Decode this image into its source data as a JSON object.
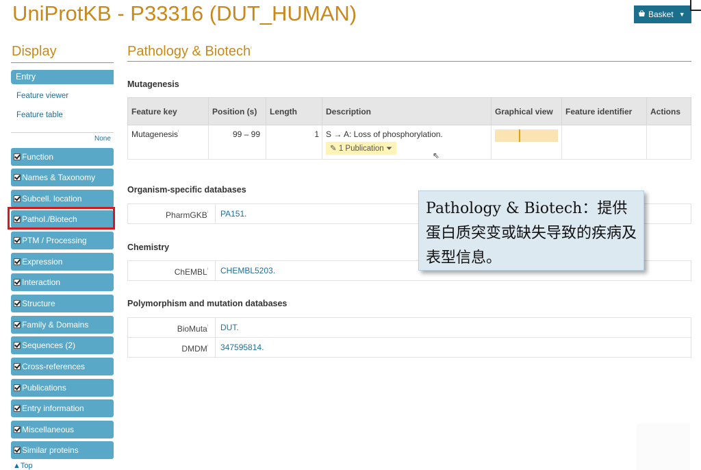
{
  "header": {
    "title": "UniProtKB - P33316 (DUT_HUMAN)",
    "basket_label": "Basket",
    "basket_icon": "basket-icon"
  },
  "sidebar": {
    "heading": "Display",
    "entry": "Entry",
    "links": [
      "Feature viewer",
      "Feature table"
    ],
    "none_label": "None",
    "sections": [
      "Function",
      "Names & Taxonomy",
      "Subcell. location",
      "Pathol./Biotech",
      "PTM / Processing",
      "Expression",
      "Interaction",
      "Structure",
      "Family & Domains",
      "Sequences (2)",
      "Cross-references",
      "Publications",
      "Entry information",
      "Miscellaneous",
      "Similar proteins"
    ],
    "highlighted": "Pathol./Biotech",
    "top_link": "Top"
  },
  "main": {
    "section_title": "Pathology & Biotech",
    "mutagenesis": {
      "heading": "Mutagenesis",
      "columns": [
        "Feature key",
        "Position (s)",
        "Length",
        "Description",
        "Graphical view",
        "Feature identifier",
        "Actions"
      ],
      "rows": [
        {
          "feature_key": "Mutagenesis",
          "position": "99 – 99",
          "length": "1",
          "description": "S → A: Loss of phosphorylation.",
          "publication": "1 Publication"
        }
      ]
    },
    "organism_db": {
      "heading": "Organism-specific databases",
      "rows": [
        {
          "key": "PharmGKB",
          "value": "PA151."
        }
      ]
    },
    "chemistry": {
      "heading": "Chemistry",
      "rows": [
        {
          "key": "ChEMBL",
          "value": "CHEMBL5203."
        }
      ]
    },
    "polymorphism": {
      "heading": "Polymorphism and mutation databases",
      "rows": [
        {
          "key": "BioMuta",
          "value": "DUT."
        },
        {
          "key": "DMDM",
          "value": "347595814."
        }
      ]
    }
  },
  "callout": {
    "text": "Pathology & Biotech：提供蛋白质突变或缺失导致的疾病及表型信息。"
  },
  "colors": {
    "accent": "#c8891a",
    "sidebar_button": "#5aa8c8",
    "highlight_border": "#d21c1c",
    "link": "#1c6f9c"
  }
}
